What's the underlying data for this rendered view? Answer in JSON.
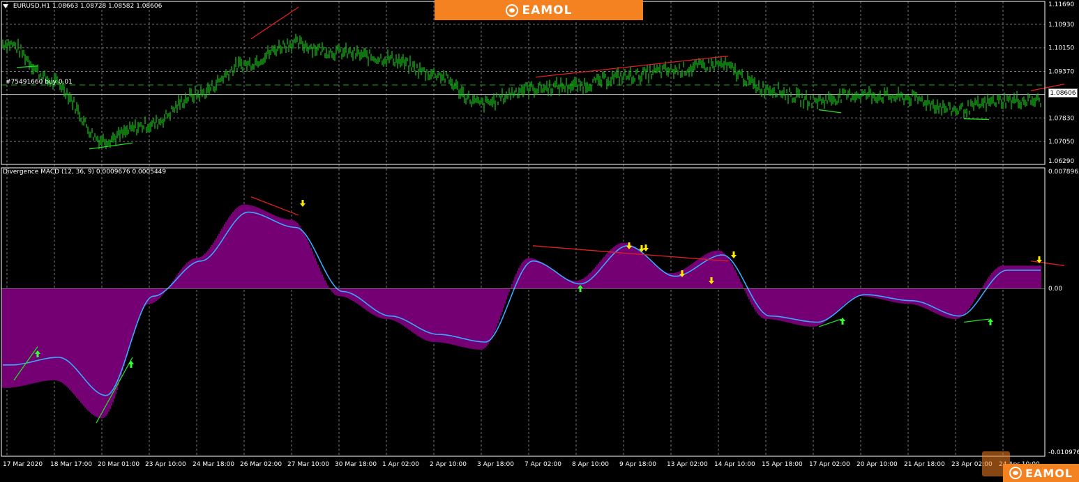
{
  "top_pane": {
    "symbol_label": "EURUSD,H1",
    "ohlc": "1.08663 1.08728 1.08582 1.08606",
    "order_label": "#75491660 buy 0.01",
    "current_price": "1.08606",
    "price_ticks": [
      "1.11690",
      "1.10930",
      "1.10150",
      "1.09370",
      "1.07830",
      "1.07050",
      "1.06290"
    ]
  },
  "bottom_pane": {
    "indicator_label": "Divergence MACD (12, 36, 9) 0.0009676 0.0005449",
    "value_ticks": [
      "0.0078963",
      "0.00",
      "-0.0109763"
    ]
  },
  "time_ticks": [
    "17 Mar 2020",
    "18 Mar 17:00",
    "20 Mar 01:00",
    "23 Apr 10:00",
    "24 Mar 18:00",
    "26 Mar 02:00",
    "27 Mar 10:00",
    "30 Mar 18:00",
    "1 Apr 02:00",
    "2 Apr 10:00",
    "3 Apr 18:00",
    "7 Apr 02:00",
    "8 Apr 10:00",
    "9 Apr 18:00",
    "13 Apr 02:00",
    "14 Apr 10:00",
    "15 Apr 18:00",
    "17 Apr 02:00",
    "20 Apr 10:00",
    "21 Apr 18:00",
    "23 Apr 02:00",
    "24 Apr 10:00"
  ],
  "branding": {
    "banner_text": "EAMOL",
    "corner_text": "EAMOL"
  },
  "colors": {
    "price_bars": "#19c419",
    "histogram": "#9b009b",
    "signal_line": "#3ba7ff",
    "divergence_bear": "#e02020",
    "divergence_bull": "#22dd22",
    "down_arrow": "#ffea00",
    "up_arrow": "#33ff33",
    "banner": "#f58220",
    "grid": "#9aa0a6"
  },
  "chart_data": [
    {
      "type": "line",
      "title": "EURUSD,H1",
      "x": [
        "17 Mar 2020",
        "18 Mar 17:00",
        "20 Mar 01:00",
        "23 Apr 10:00",
        "24 Mar 18:00",
        "26 Mar 02:00",
        "27 Mar 10:00",
        "30 Mar 18:00",
        "1 Apr 02:00",
        "2 Apr 10:00",
        "3 Apr 18:00",
        "7 Apr 02:00",
        "8 Apr 10:00",
        "9 Apr 18:00",
        "13 Apr 02:00",
        "14 Apr 10:00",
        "15 Apr 18:00",
        "17 Apr 02:00",
        "20 Apr 10:00",
        "21 Apr 18:00",
        "23 Apr 02:00",
        "24 Apr 10:00"
      ],
      "series": [
        {
          "values": [
            1.103,
            1.09,
            1.071,
            1.076,
            1.086,
            1.096,
            1.103,
            1.1,
            1.098,
            1.093,
            1.083,
            1.088,
            1.089,
            1.092,
            1.094,
            1.096,
            1.088,
            1.084,
            1.086,
            1.085,
            1.081,
            1.084
          ]
        }
      ],
      "ylim": [
        1.0629,
        1.1169
      ]
    },
    {
      "type": "bar",
      "title": "Divergence MACD (12, 36, 9) 0.0009676 0.0005449",
      "x": [
        "17 Mar 2020",
        "18 Mar 17:00",
        "20 Mar 01:00",
        "23 Apr 10:00",
        "24 Mar 18:00",
        "26 Mar 02:00",
        "27 Mar 10:00",
        "30 Mar 18:00",
        "1 Apr 02:00",
        "2 Apr 10:00",
        "3 Apr 18:00",
        "7 Apr 02:00",
        "8 Apr 10:00",
        "9 Apr 18:00",
        "13 Apr 02:00",
        "14 Apr 10:00",
        "15 Apr 18:00",
        "17 Apr 02:00",
        "20 Apr 10:00",
        "21 Apr 18:00",
        "23 Apr 02:00",
        "24 Apr 10:00"
      ],
      "series": [
        {
          "values": [
            -0.0065,
            -0.006,
            -0.0085,
            -0.001,
            0.002,
            0.0055,
            0.0045,
            -0.0005,
            -0.002,
            -0.0035,
            -0.004,
            0.002,
            0.0005,
            0.003,
            0.001,
            0.0025,
            -0.002,
            -0.0025,
            -0.0005,
            -0.001,
            -0.002,
            0.0015
          ]
        },
        {
          "values": [
            -0.005,
            -0.0045,
            -0.007,
            -0.0005,
            0.0018,
            0.005,
            0.004,
            -0.0002,
            -0.0018,
            -0.003,
            -0.0035,
            0.0018,
            0.0003,
            0.0028,
            0.0008,
            0.0022,
            -0.0018,
            -0.0022,
            -0.0004,
            -0.0008,
            -0.0018,
            0.0012
          ]
        }
      ],
      "ylim": [
        -0.0109763,
        0.0078963
      ]
    }
  ]
}
